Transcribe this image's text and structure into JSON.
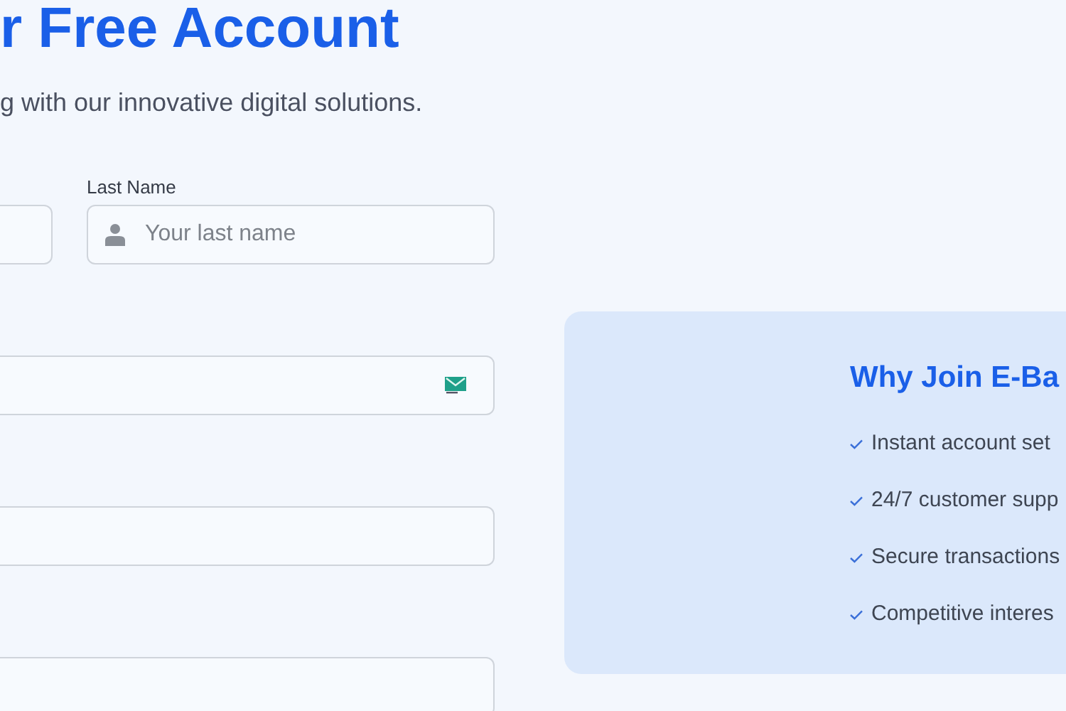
{
  "page_title": "r Free Account",
  "subtitle": "g with our innovative digital solutions.",
  "last_name": {
    "label": "Last Name",
    "placeholder": "Your last name"
  },
  "benefits": {
    "title": "Why Join E-Ba",
    "items": [
      "Instant account set",
      "24/7 customer supp",
      "Secure transactions",
      "Competitive interes"
    ]
  }
}
